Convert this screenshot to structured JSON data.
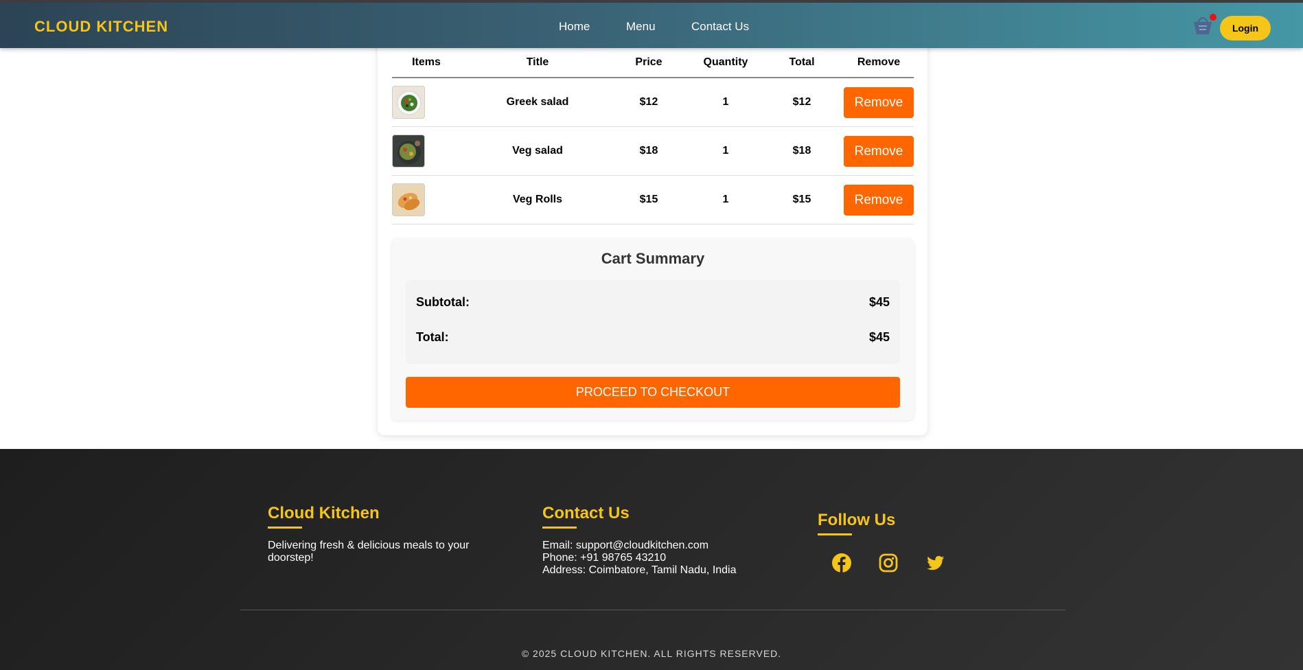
{
  "header": {
    "brand": "CLOUD KITCHEN",
    "nav": [
      "Home",
      "Menu",
      "Contact Us"
    ],
    "login_label": "Login",
    "cart_icon": "basket-icon",
    "accent_color": "#f5c518"
  },
  "cart": {
    "columns": [
      "Items",
      "Title",
      "Price",
      "Quantity",
      "Total",
      "Remove"
    ],
    "items": [
      {
        "image": "greek-salad-image",
        "title": "Greek salad",
        "price": "$12",
        "quantity": "1",
        "total": "$12",
        "remove_label": "Remove"
      },
      {
        "image": "veg-salad-image",
        "title": "Veg salad",
        "price": "$18",
        "quantity": "1",
        "total": "$18",
        "remove_label": "Remove"
      },
      {
        "image": "veg-rolls-image",
        "title": "Veg Rolls",
        "price": "$15",
        "quantity": "1",
        "total": "$15",
        "remove_label": "Remove"
      }
    ],
    "button_color": "#ff6600"
  },
  "summary": {
    "title": "Cart Summary",
    "subtotal_label": "Subtotal:",
    "subtotal_value": "$45",
    "total_label": "Total:",
    "total_value": "$45",
    "checkout_label": "PROCEED TO CHECKOUT"
  },
  "footer": {
    "about": {
      "title": "Cloud Kitchen",
      "text": "Delivering fresh & delicious meals to your doorstep!"
    },
    "contact": {
      "title": "Contact Us",
      "email": "Email: support@cloudkitchen.com",
      "phone": "Phone: +91 98765 43210",
      "address": "Address: Coimbatore, Tamil Nadu, India"
    },
    "follow": {
      "title": "Follow Us",
      "icons": [
        "facebook-icon",
        "instagram-icon",
        "twitter-icon"
      ]
    },
    "copyright": "© 2025 CLOUD KITCHEN. ALL RIGHTS RESERVED."
  }
}
